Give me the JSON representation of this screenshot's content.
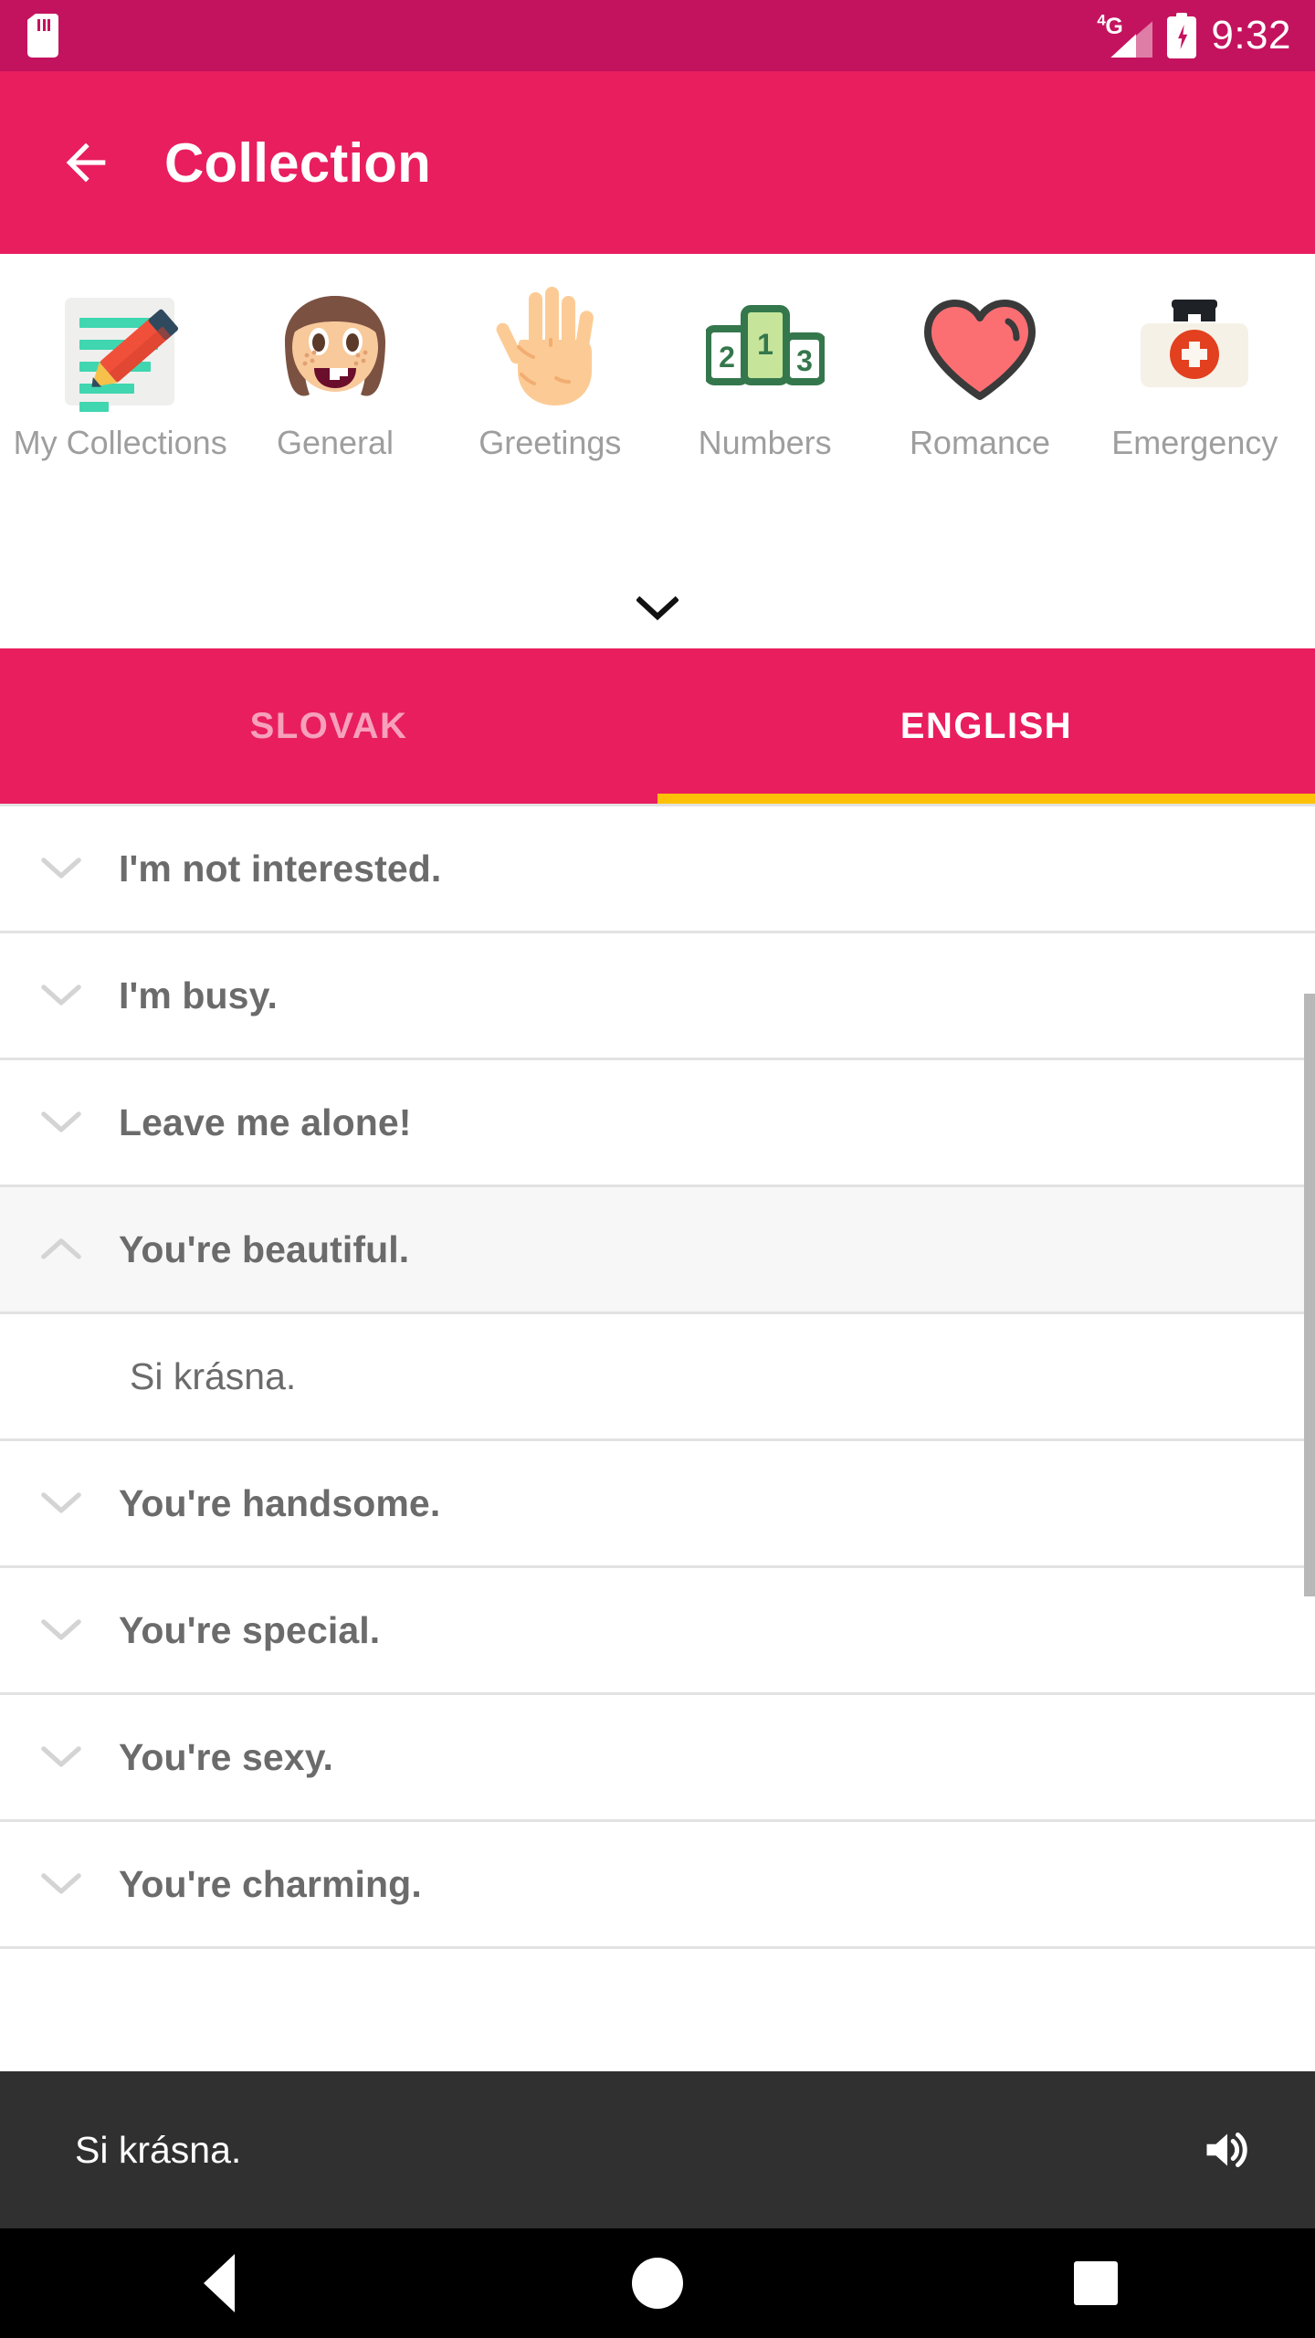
{
  "status_bar": {
    "sd_card_icon": "sd-card-icon",
    "network_type": "4G",
    "signal_icon": "signal-bars-icon",
    "battery_icon": "battery-charging-icon",
    "time": "9:32",
    "background_color": "#C4135E"
  },
  "app_bar": {
    "back_icon": "arrow-left-icon",
    "title": "Collection",
    "background_color": "#E91E5F"
  },
  "categories": {
    "items": [
      {
        "label": "My Collections",
        "icon": "memo-pencil-icon"
      },
      {
        "label": "General",
        "icon": "girl-face-icon"
      },
      {
        "label": "Greetings",
        "icon": "raised-hand-icon"
      },
      {
        "label": "Numbers",
        "icon": "podium-123-icon"
      },
      {
        "label": "Romance",
        "icon": "heart-icon"
      },
      {
        "label": "Emergency",
        "icon": "medical-bag-icon"
      }
    ],
    "expand_icon": "chevron-down-icon",
    "podium_numbers": {
      "second": "2",
      "first": "1",
      "third": "3"
    }
  },
  "tabs": {
    "items": [
      {
        "label": "SLOVAK",
        "active": false
      },
      {
        "label": "ENGLISH",
        "active": true
      }
    ],
    "indicator_color": "#FFC107",
    "background_color": "#E91E5F"
  },
  "phrase_list": {
    "rows": [
      {
        "text": "I'm not interested.",
        "expanded": false,
        "chevron": "chevron-down-icon"
      },
      {
        "text": "I'm busy.",
        "expanded": false,
        "chevron": "chevron-down-icon"
      },
      {
        "text": "Leave me alone!",
        "expanded": false,
        "chevron": "chevron-down-icon"
      },
      {
        "text": "You're beautiful.",
        "expanded": true,
        "chevron": "chevron-up-icon",
        "translation": "Si krásna."
      },
      {
        "text": "You're handsome.",
        "expanded": false,
        "chevron": "chevron-down-icon"
      },
      {
        "text": "You're special.",
        "expanded": false,
        "chevron": "chevron-down-icon"
      },
      {
        "text": "You're sexy.",
        "expanded": false,
        "chevron": "chevron-down-icon"
      },
      {
        "text": "You're charming.",
        "expanded": false,
        "chevron": "chevron-down-icon"
      }
    ]
  },
  "player_bar": {
    "text": "Si krásna.",
    "speaker_icon": "speaker-volume-icon",
    "background_color": "#303030"
  },
  "nav_bar": {
    "back_icon": "triangle-back-icon",
    "home_icon": "circle-home-icon",
    "recents_icon": "square-recents-icon"
  }
}
